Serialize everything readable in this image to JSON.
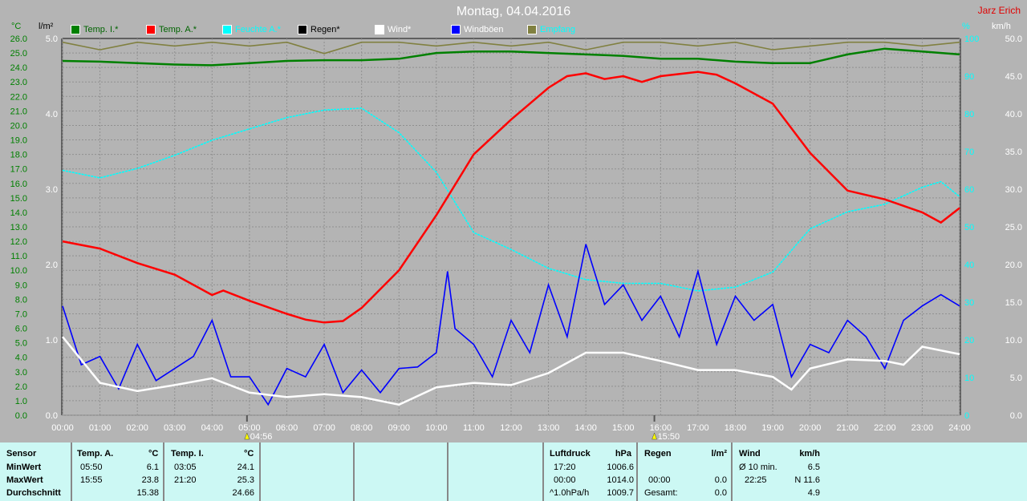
{
  "header": {
    "title": "Montag, 04.04.2016",
    "author": "Jarz Erich"
  },
  "axes": {
    "left1_unit": "°C",
    "left2_unit": "l/m²",
    "right1_unit": "%",
    "right2_unit": "km/h"
  },
  "legend": [
    {
      "label": "Temp. I.*",
      "color": "#008000",
      "text_color": "#006400"
    },
    {
      "label": "Temp. A.*",
      "color": "#ff0000",
      "text_color": "#006400"
    },
    {
      "label": "Feuchte A.*",
      "color": "#00ffff",
      "text_color": "#00ffff"
    },
    {
      "label": "Regen*",
      "color": "#000000",
      "text_color": "#000000"
    },
    {
      "label": "Wind*",
      "color": "#ffffff",
      "text_color": "#ffffff"
    },
    {
      "label": "Windböen",
      "color": "#0000ff",
      "text_color": "#ffffff"
    },
    {
      "label": "Empfang",
      "color": "#808040",
      "text_color": "#00ffff"
    }
  ],
  "sun": {
    "sunrise": "04:56",
    "sunset": "15:50"
  },
  "chart_data": {
    "type": "line",
    "title": "Montag, 04.04.2016",
    "x_ticks": [
      "00:00",
      "01:00",
      "02:00",
      "03:00",
      "04:00",
      "05:00",
      "06:00",
      "07:00",
      "08:00",
      "09:00",
      "10:00",
      "11:00",
      "12:00",
      "13:00",
      "14:00",
      "15:00",
      "16:00",
      "17:00",
      "18:00",
      "19:00",
      "20:00",
      "21:00",
      "22:00",
      "23:00",
      "24:00"
    ],
    "xlim": [
      0,
      24
    ],
    "y_temp": {
      "label": "°C",
      "range": [
        0,
        26
      ],
      "step": 1
    },
    "y_rain": {
      "label": "l/m²",
      "range": [
        0,
        5
      ],
      "ticks": [
        "0.0",
        "1.0",
        "2.0",
        "3.0",
        "4.0",
        "5.0"
      ]
    },
    "y_hum": {
      "label": "%",
      "range": [
        0,
        100
      ],
      "step": 10
    },
    "y_wind": {
      "label": "km/h",
      "range": [
        0,
        50
      ],
      "step": 5
    },
    "grid": true,
    "series": [
      {
        "name": "Temp. I.*",
        "axis": "temp",
        "color": "#008000",
        "x": [
          0,
          1,
          2,
          3,
          4,
          5,
          6,
          7,
          8,
          9,
          10,
          11,
          12,
          13,
          14,
          15,
          16,
          17,
          18,
          19,
          20,
          21,
          22,
          23,
          24
        ],
        "y": [
          24.45,
          24.4,
          24.3,
          24.2,
          24.15,
          24.3,
          24.45,
          24.5,
          24.5,
          24.6,
          25.0,
          25.1,
          25.1,
          25.0,
          24.9,
          24.8,
          24.6,
          24.6,
          24.4,
          24.3,
          24.3,
          24.9,
          25.3,
          25.1,
          24.9
        ]
      },
      {
        "name": "Temp. A.*",
        "axis": "temp",
        "color": "#ff0000",
        "x": [
          0,
          1,
          2,
          3,
          4,
          4.3,
          5,
          6,
          6.5,
          7,
          7.5,
          8,
          9,
          10,
          10.5,
          11,
          12,
          13,
          13.5,
          14,
          14.5,
          15,
          15.5,
          16,
          17,
          17.5,
          18,
          19,
          20,
          21,
          22,
          23,
          23.5,
          24
        ],
        "y": [
          12.0,
          11.5,
          10.5,
          9.7,
          8.3,
          8.6,
          7.9,
          7.0,
          6.6,
          6.4,
          6.5,
          7.4,
          10.0,
          13.8,
          15.9,
          18.0,
          20.4,
          22.6,
          23.4,
          23.6,
          23.2,
          23.4,
          23.0,
          23.4,
          23.7,
          23.5,
          22.9,
          21.5,
          18.1,
          15.5,
          14.9,
          14.0,
          13.3,
          14.3
        ]
      },
      {
        "name": "Feuchte A.*",
        "axis": "hum",
        "color": "#00ffff",
        "x": [
          0,
          1,
          2,
          3,
          4,
          5,
          6,
          7,
          8,
          9,
          10,
          11,
          12,
          13,
          14,
          15,
          16,
          17,
          18,
          19,
          20,
          21,
          22,
          23,
          23.5,
          24
        ],
        "y": [
          65,
          63,
          65.5,
          69,
          73,
          76,
          79,
          81,
          81.5,
          75,
          64.5,
          48.5,
          44,
          39,
          36,
          35,
          35,
          33,
          34,
          38,
          49.5,
          54,
          56,
          60.5,
          62,
          58
        ]
      },
      {
        "name": "Wind*",
        "axis": "wind",
        "color": "#ffffff",
        "x": [
          0,
          1,
          2,
          3,
          4,
          5,
          6,
          7,
          8,
          9,
          10,
          11,
          12,
          13,
          14,
          15,
          16,
          17,
          18,
          19,
          19.5,
          20,
          21,
          22,
          22.5,
          23,
          24
        ],
        "y": [
          10.4,
          4.3,
          3.2,
          4.0,
          4.9,
          3.0,
          2.4,
          2.8,
          2.4,
          1.4,
          3.7,
          4.3,
          4.0,
          5.6,
          8.3,
          8.3,
          7.2,
          6.0,
          6.0,
          5.1,
          3.4,
          6.2,
          7.4,
          7.2,
          6.7,
          9.1,
          8.1
        ]
      },
      {
        "name": "Windböen",
        "axis": "wind",
        "color": "#0000ff",
        "x": [
          0,
          0.5,
          1,
          1.5,
          2,
          2.5,
          3,
          3.5,
          4,
          4.5,
          5,
          5.5,
          6,
          6.5,
          7,
          7.5,
          8,
          8.5,
          9,
          9.5,
          10,
          10.3,
          10.5,
          11,
          11.5,
          12,
          12.5,
          13,
          13.5,
          14,
          14.5,
          15,
          15.5,
          16,
          16.5,
          17,
          17.5,
          18,
          18.5,
          19,
          19.5,
          20,
          20.5,
          21,
          21.5,
          22,
          22.5,
          23,
          23.5,
          24
        ],
        "y": [
          14.5,
          6.7,
          7.8,
          3.5,
          9.4,
          4.6,
          6.2,
          7.8,
          12.6,
          5.1,
          5.1,
          1.4,
          6.2,
          5.1,
          9.4,
          3.0,
          6.0,
          3.0,
          6.2,
          6.4,
          8.3,
          19.1,
          11.5,
          9.4,
          5.1,
          12.6,
          8.3,
          17.3,
          10.4,
          22.7,
          14.7,
          17.3,
          12.6,
          15.8,
          10.4,
          19.1,
          9.4,
          15.8,
          12.6,
          14.7,
          5.1,
          9.4,
          8.3,
          12.6,
          10.4,
          6.2,
          12.6,
          14.5,
          16.0,
          14.5
        ]
      },
      {
        "name": "Empfang",
        "axis": "hum",
        "color": "#808040",
        "x": [
          0,
          1,
          2,
          3,
          4,
          5,
          6,
          7,
          8,
          9,
          10,
          11,
          12,
          13,
          14,
          15,
          16,
          17,
          18,
          19,
          20,
          21,
          22,
          23,
          24
        ],
        "y": [
          99,
          97,
          99,
          98,
          99,
          98,
          99,
          96,
          99,
          99,
          98,
          99,
          98,
          99,
          97,
          99,
          99,
          98,
          99,
          97,
          98,
          99,
          99,
          98,
          99
        ]
      }
    ]
  },
  "table": {
    "sensor": {
      "header": "Sensor",
      "rows": [
        "MinWert",
        "MaxWert",
        "Durchschnitt"
      ]
    },
    "temp_a": {
      "header": "Temp. A.",
      "unit": "°C",
      "min_time": "05:50",
      "min": "6.1",
      "max_time": "15:55",
      "max": "23.8",
      "avg": "15.38"
    },
    "temp_i": {
      "header": "Temp. I.",
      "unit": "°C",
      "min_time": "03:05",
      "min": "24.1",
      "max_time": "21:20",
      "max": "25.3",
      "avg": "24.66"
    },
    "pressure": {
      "header": "Luftdruck",
      "unit": "hPa",
      "r1_label": "17:20",
      "r1": "1006.6",
      "r2_label": "00:00",
      "r2": "1014.0",
      "r3_label": "^1.0hPa/h",
      "r3": "1009.7"
    },
    "rain": {
      "header": "Regen",
      "unit": "l/m²",
      "r2_label": "00:00",
      "r2": "0.0",
      "r3_label": "Gesamt:",
      "r3": "0.0"
    },
    "wind": {
      "header": "Wind",
      "unit": "km/h",
      "r1_label": "Ø 10 min.",
      "r1": "6.5",
      "r2_label": "22:25",
      "r2": "N 11.6",
      "r3": "4.9"
    }
  }
}
